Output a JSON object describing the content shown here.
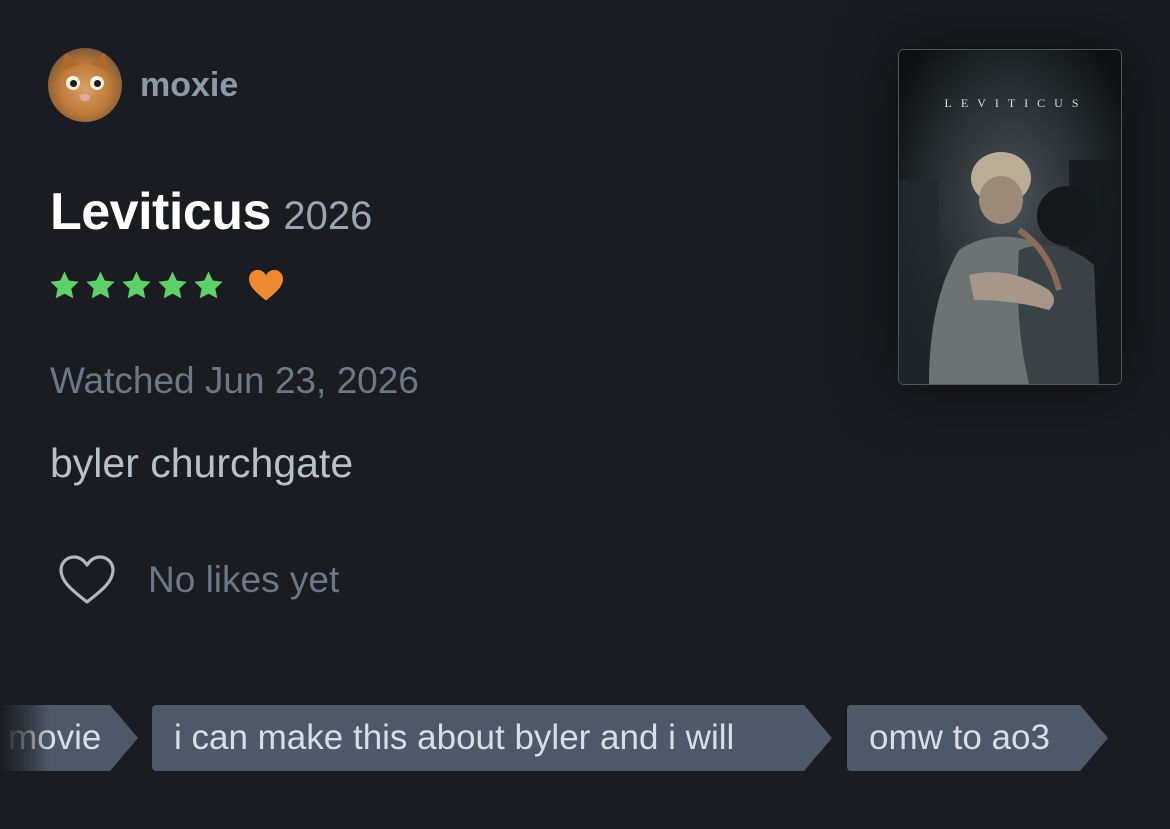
{
  "reviewer": {
    "username": "moxie"
  },
  "film": {
    "title": "Leviticus",
    "year": "2026",
    "rating_stars": 5,
    "rating_max": 5,
    "liked": true
  },
  "colors": {
    "star": "#5ed16a",
    "like_heart": "#f08a30",
    "tag_bg": "#4d5868"
  },
  "review": {
    "watched": "Watched Jun 23, 2026",
    "body": "byler churchgate"
  },
  "likes": {
    "text": "No likes yet"
  },
  "poster": {
    "title": "LEVITICUS"
  },
  "tags": [
    "movie",
    "i can make this about byler and i will",
    "omw to ao3"
  ]
}
